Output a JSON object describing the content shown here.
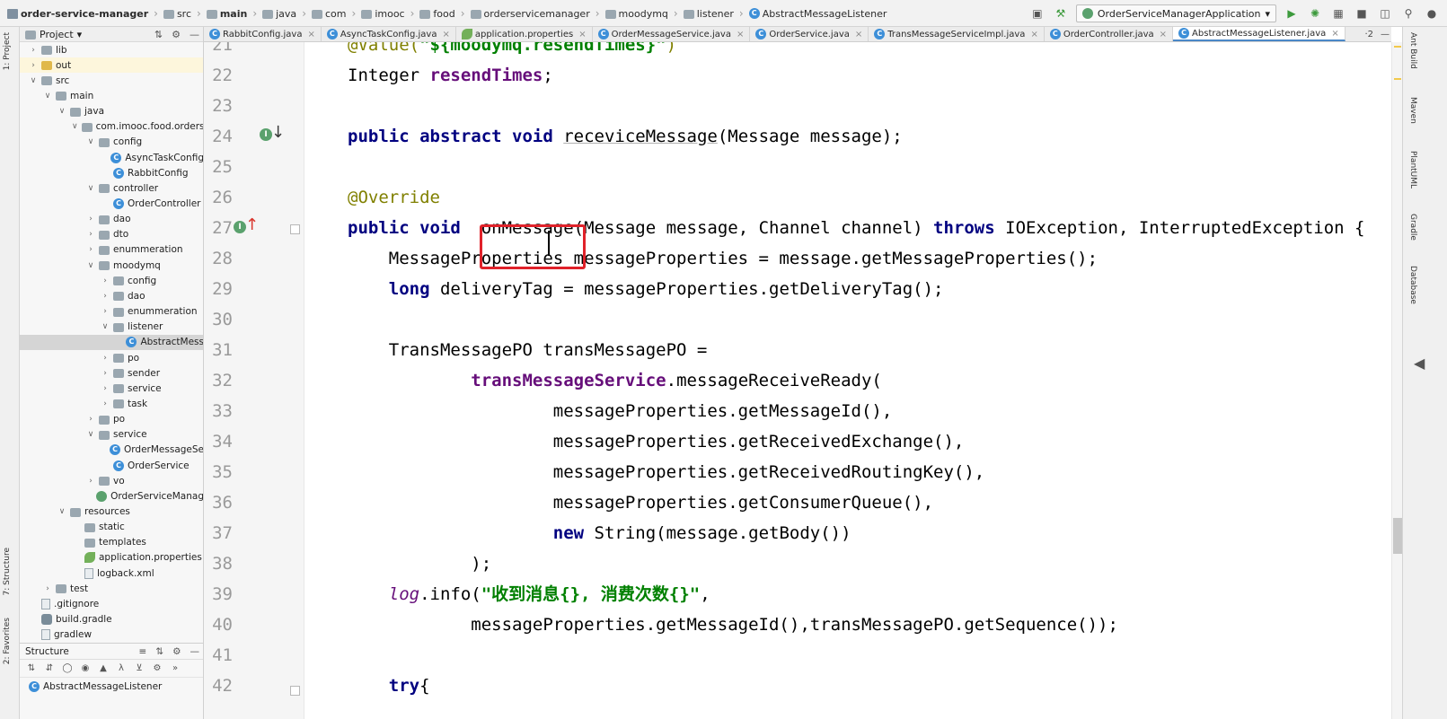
{
  "breadcrumbs": [
    {
      "label": "order-service-manager",
      "icon": "project-icon",
      "bold": true
    },
    {
      "label": "src",
      "icon": "folder-icon"
    },
    {
      "label": "main",
      "icon": "folder-icon",
      "bold": true
    },
    {
      "label": "java",
      "icon": "folder-icon"
    },
    {
      "label": "com",
      "icon": "folder-icon"
    },
    {
      "label": "imooc",
      "icon": "folder-icon"
    },
    {
      "label": "food",
      "icon": "folder-icon"
    },
    {
      "label": "orderservicemanager",
      "icon": "folder-icon"
    },
    {
      "label": "moodymq",
      "icon": "folder-icon"
    },
    {
      "label": "listener",
      "icon": "folder-icon"
    },
    {
      "label": "AbstractMessageListener",
      "icon": "class-icon"
    }
  ],
  "run_config": {
    "label": "OrderServiceManagerApplication"
  },
  "left_tool_tabs": {
    "project": "1: Project",
    "structure": "7: Structure",
    "favorites": "2: Favorites"
  },
  "right_tool_tabs": {
    "ant": "Ant Build",
    "maven": "Maven",
    "plantuml": "PlantUML",
    "gradle": "Gradle",
    "database": "Database"
  },
  "project_panel": {
    "title": "Project",
    "tree": [
      {
        "label": "lib",
        "depth": 0,
        "arrow": "right",
        "icon": "folder"
      },
      {
        "label": "out",
        "depth": 0,
        "arrow": "right",
        "icon": "folder-yellow",
        "highlight": true
      },
      {
        "label": "src",
        "depth": 0,
        "arrow": "down",
        "icon": "folder"
      },
      {
        "label": "main",
        "depth": 1,
        "arrow": "down",
        "icon": "folder"
      },
      {
        "label": "java",
        "depth": 2,
        "arrow": "down",
        "icon": "folder"
      },
      {
        "label": "com.imooc.food.orderse",
        "depth": 3,
        "arrow": "down",
        "icon": "folder"
      },
      {
        "label": "config",
        "depth": 4,
        "arrow": "down",
        "icon": "folder"
      },
      {
        "label": "AsyncTaskConfig",
        "depth": 5,
        "arrow": "",
        "icon": "class"
      },
      {
        "label": "RabbitConfig",
        "depth": 5,
        "arrow": "",
        "icon": "class"
      },
      {
        "label": "controller",
        "depth": 4,
        "arrow": "down",
        "icon": "folder"
      },
      {
        "label": "OrderController",
        "depth": 5,
        "arrow": "",
        "icon": "class"
      },
      {
        "label": "dao",
        "depth": 4,
        "arrow": "right",
        "icon": "folder"
      },
      {
        "label": "dto",
        "depth": 4,
        "arrow": "right",
        "icon": "folder"
      },
      {
        "label": "enummeration",
        "depth": 4,
        "arrow": "right",
        "icon": "folder"
      },
      {
        "label": "moodymq",
        "depth": 4,
        "arrow": "down",
        "icon": "folder"
      },
      {
        "label": "config",
        "depth": 5,
        "arrow": "right",
        "icon": "folder"
      },
      {
        "label": "dao",
        "depth": 5,
        "arrow": "right",
        "icon": "folder"
      },
      {
        "label": "enummeration",
        "depth": 5,
        "arrow": "right",
        "icon": "folder"
      },
      {
        "label": "listener",
        "depth": 5,
        "arrow": "down",
        "icon": "folder"
      },
      {
        "label": "AbstractMess",
        "depth": 6,
        "arrow": "",
        "icon": "class",
        "selected": true
      },
      {
        "label": "po",
        "depth": 5,
        "arrow": "right",
        "icon": "folder"
      },
      {
        "label": "sender",
        "depth": 5,
        "arrow": "right",
        "icon": "folder"
      },
      {
        "label": "service",
        "depth": 5,
        "arrow": "right",
        "icon": "folder"
      },
      {
        "label": "task",
        "depth": 5,
        "arrow": "right",
        "icon": "folder"
      },
      {
        "label": "po",
        "depth": 4,
        "arrow": "right",
        "icon": "folder"
      },
      {
        "label": "service",
        "depth": 4,
        "arrow": "down",
        "icon": "folder"
      },
      {
        "label": "OrderMessageSe",
        "depth": 5,
        "arrow": "",
        "icon": "class"
      },
      {
        "label": "OrderService",
        "depth": 5,
        "arrow": "",
        "icon": "class"
      },
      {
        "label": "vo",
        "depth": 4,
        "arrow": "right",
        "icon": "folder"
      },
      {
        "label": "OrderServiceManag",
        "depth": 4,
        "arrow": "",
        "icon": "class-green"
      },
      {
        "label": "resources",
        "depth": 2,
        "arrow": "down",
        "icon": "folder"
      },
      {
        "label": "static",
        "depth": 3,
        "arrow": "",
        "icon": "folder"
      },
      {
        "label": "templates",
        "depth": 3,
        "arrow": "",
        "icon": "folder"
      },
      {
        "label": "application.properties",
        "depth": 3,
        "arrow": "",
        "icon": "leaf"
      },
      {
        "label": "logback.xml",
        "depth": 3,
        "arrow": "",
        "icon": "file"
      },
      {
        "label": "test",
        "depth": 1,
        "arrow": "right",
        "icon": "folder"
      },
      {
        "label": ".gitignore",
        "depth": 0,
        "arrow": "",
        "icon": "file"
      },
      {
        "label": "build.gradle",
        "depth": 0,
        "arrow": "",
        "icon": "gradle"
      },
      {
        "label": "gradlew",
        "depth": 0,
        "arrow": "",
        "icon": "file"
      }
    ]
  },
  "structure_panel": {
    "title": "Structure",
    "root": "AbstractMessageListener"
  },
  "tabs": [
    {
      "label": "RabbitConfig.java"
    },
    {
      "label": "AsyncTaskConfig.java"
    },
    {
      "label": "application.properties"
    },
    {
      "label": "OrderMessageService.java"
    },
    {
      "label": "OrderService.java"
    },
    {
      "label": "TransMessageServiceImpl.java"
    },
    {
      "label": "OrderController.java"
    },
    {
      "label": "AbstractMessageListener.java",
      "active": true
    }
  ],
  "tab_overflow": "·2",
  "editor": {
    "line_numbers": [
      "21",
      "22",
      "23",
      "24",
      "25",
      "26",
      "27",
      "28",
      "29",
      "30",
      "31",
      "32",
      "33",
      "34",
      "35",
      "36",
      "37",
      "38",
      "39",
      "40",
      "41",
      "42"
    ]
  }
}
